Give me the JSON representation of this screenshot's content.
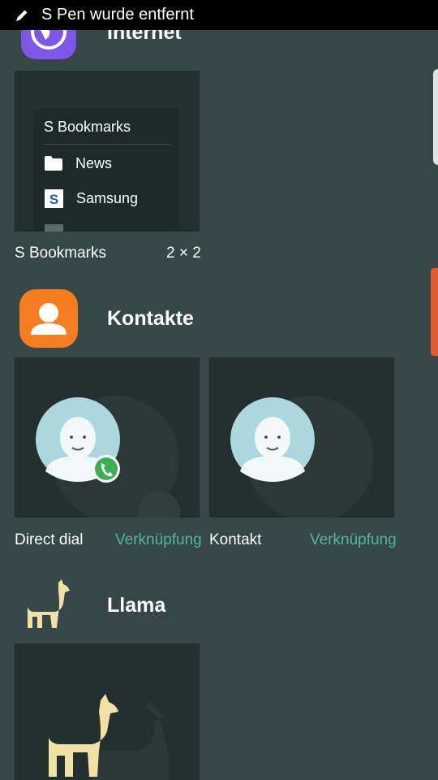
{
  "status_bar": {
    "notification": "S Pen wurde entfernt"
  },
  "sections": {
    "internet": {
      "app_name": "Internet",
      "widget": {
        "label": "S Bookmarks",
        "size": "2 × 2",
        "preview": {
          "title": "S Bookmarks",
          "items": [
            {
              "label": "News",
              "icon": "folder-icon"
            },
            {
              "label": "Samsung",
              "icon": "samsung-s-icon"
            }
          ]
        }
      }
    },
    "kontakte": {
      "app_name": "Kontakte",
      "widgets": [
        {
          "label": "Direct dial",
          "kind": "Verknüpfung",
          "icon": "contact-call-icon"
        },
        {
          "label": "Kontakt",
          "kind": "Verknüpfung",
          "icon": "contact-icon"
        }
      ]
    },
    "llama": {
      "app_name": "Llama"
    }
  },
  "colors": {
    "background": "#374747",
    "preview_bg": "#24302f",
    "accent_teal": "#4db6a6",
    "kontakte_orange": "#f57c1f",
    "internet_purple": "#7e57e6",
    "llama_cream": "#f0e2a4",
    "call_green": "#3cb054"
  }
}
